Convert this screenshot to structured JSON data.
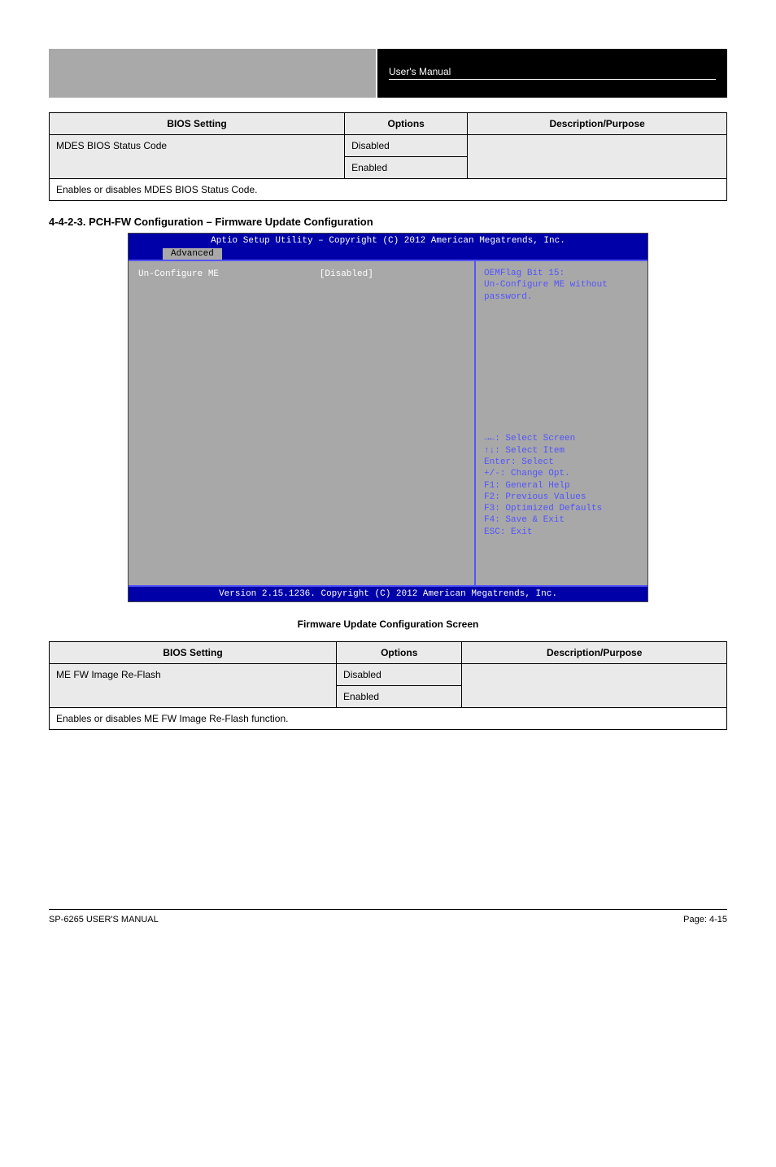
{
  "header": {
    "right_line1": "User's Manual",
    "right_line2": ""
  },
  "table1": {
    "col1_header": "BIOS Setting",
    "col2_header": "Options",
    "col3_header": "Description/Purpose",
    "row_label": "MDES BIOS Status Code",
    "opt1": "Disabled",
    "opt2": "Enabled",
    "desc": "Enables or disables MDES BIOS Status Code."
  },
  "section_title": "4-4-2-3. PCH-FW Configuration – Firmware Update Configuration",
  "bios": {
    "top": "Aptio Setup Utility – Copyright (C) 2012 American Megatrends, Inc.",
    "tab": "Advanced",
    "item_name": "Un-Configure ME",
    "item_value": "[Disabled]",
    "help1": "OEMFlag Bit 15:",
    "help2": "Un-Configure ME without",
    "help3": "password.",
    "keys": [
      "→←: Select Screen",
      "↑↓: Select Item",
      "Enter: Select",
      "+/-: Change Opt.",
      "F1: General Help",
      "F2: Previous Values",
      "F3: Optimized Defaults",
      "F4: Save & Exit",
      "ESC: Exit"
    ],
    "bottom": "Version 2.15.1236. Copyright (C) 2012 American Megatrends, Inc."
  },
  "caption": "Firmware Update Configuration Screen",
  "table2": {
    "col1_header": "BIOS Setting",
    "col2_header": "Options",
    "col3_header": "Description/Purpose",
    "row_label": "ME FW Image Re-Flash",
    "opt1": "Disabled",
    "opt2": "Enabled",
    "desc": "Enables or disables ME FW Image Re-Flash function."
  },
  "footer": {
    "left": "SP-6265 USER'S MANUAL",
    "right": "Page: 4-15"
  }
}
